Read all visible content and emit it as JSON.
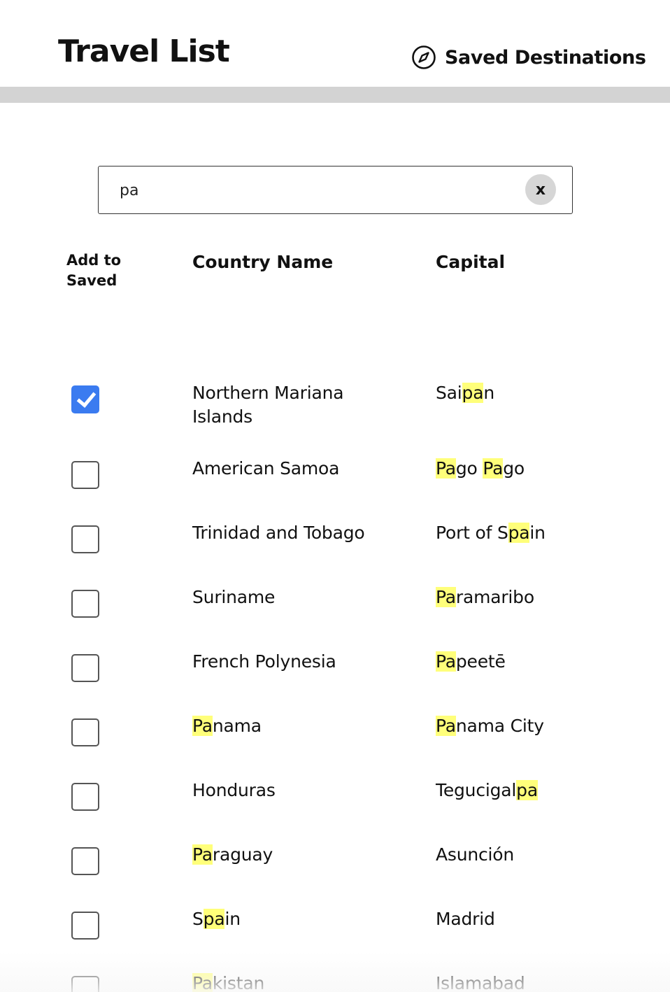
{
  "header": {
    "title": "Travel List",
    "saved_link_label": "Saved Destinations",
    "saved_link_icon": "compass-icon"
  },
  "search": {
    "value": "pa",
    "clear_label": "x"
  },
  "table": {
    "columns": [
      "Add to Saved",
      "Country Name",
      "Capital"
    ],
    "rows": [
      {
        "checked": true,
        "country": "Northern Mariana Islands",
        "capital": "Saipan"
      },
      {
        "checked": false,
        "country": "American Samoa",
        "capital": "Pago Pago"
      },
      {
        "checked": false,
        "country": "Trinidad and Tobago",
        "capital": "Port of Spain"
      },
      {
        "checked": false,
        "country": "Suriname",
        "capital": "Paramaribo"
      },
      {
        "checked": false,
        "country": "French Polynesia",
        "capital": "Papeetē"
      },
      {
        "checked": false,
        "country": "Panama",
        "capital": "Panama City"
      },
      {
        "checked": false,
        "country": "Honduras",
        "capital": "Tegucigalpa"
      },
      {
        "checked": false,
        "country": "Paraguay",
        "capital": "Asunción"
      },
      {
        "checked": false,
        "country": "Spain",
        "capital": "Madrid"
      },
      {
        "checked": false,
        "country": "Pakistan",
        "capital": "Islamabad"
      }
    ]
  },
  "colors": {
    "highlight": "#ffff7a",
    "checkbox_checked": "#3a7bf0",
    "divider": "#d3d3d3"
  }
}
